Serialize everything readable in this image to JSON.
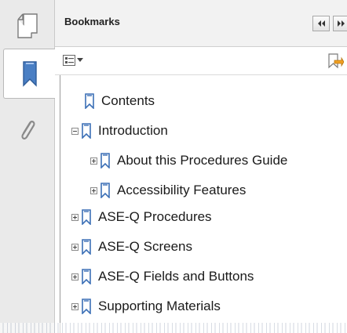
{
  "rail": {
    "icons": [
      "pages-icon",
      "bookmarks-icon",
      "attachments-icon"
    ]
  },
  "panel": {
    "title": "Bookmarks",
    "collapse_icon": "double-left-arrow-icon",
    "expand_icon": "double-right-arrow-icon"
  },
  "toolbar": {
    "options_icon": "options-menu-icon",
    "new_bookmark_icon": "new-bookmark-icon"
  },
  "colors": {
    "bookmark_icon": "#3b6fb6",
    "rail_bg": "#eaeaea",
    "header_bg": "#f2f2f2"
  },
  "bookmarks": [
    {
      "label": "Contents",
      "level": 0,
      "toggle": "none"
    },
    {
      "label": "Introduction",
      "level": 0,
      "toggle": "minus"
    },
    {
      "label": "About this Procedures Guide",
      "level": 1,
      "toggle": "plus"
    },
    {
      "label": "Accessibility Features",
      "level": 1,
      "toggle": "plus"
    },
    {
      "label": "ASE-Q Procedures",
      "level": 0,
      "toggle": "plus"
    },
    {
      "label": "ASE-Q Screens",
      "level": 0,
      "toggle": "plus"
    },
    {
      "label": "ASE-Q Fields and Buttons",
      "level": 0,
      "toggle": "plus"
    },
    {
      "label": "Supporting Materials",
      "level": 0,
      "toggle": "plus"
    }
  ]
}
